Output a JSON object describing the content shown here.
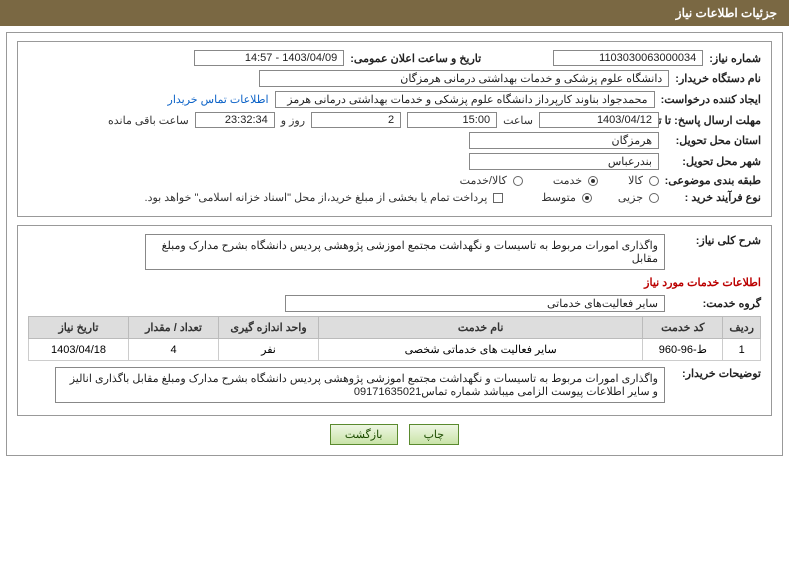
{
  "header": {
    "title": "جزئیات اطلاعات نیاز"
  },
  "fields": {
    "need_no_label": "شماره نیاز:",
    "need_no": "1103030063000034",
    "announce_label": "تاریخ و ساعت اعلان عمومی:",
    "announce": "1403/04/09 - 14:57",
    "buyer_org_label": "نام دستگاه خریدار:",
    "buyer_org": "دانشگاه علوم پزشکی و خدمات بهداشتی درمانی هرمزگان",
    "requestor_label": "ایجاد کننده درخواست:",
    "requestor": "محمدجواد بناوند کارپرداز دانشگاه علوم پزشکی و خدمات بهداشتی درمانی هرمز",
    "contact_link": "اطلاعات تماس خریدار",
    "deadline_label": "مهلت ارسال پاسخ: تا تاریخ:",
    "deadline_date": "1403/04/12",
    "time_lbl": "ساعت",
    "deadline_time": "15:00",
    "days_val": "2",
    "days_suffix": "روز و",
    "remain_time": "23:32:34",
    "remain_suffix": "ساعت باقی مانده",
    "province_label": "استان محل تحویل:",
    "province": "هرمزگان",
    "city_label": "شهر محل تحویل:",
    "city": "بندرعباس",
    "subject_cat_label": "طبقه بندی موضوعی:",
    "cat_goods": "کالا",
    "cat_service": "خدمت",
    "cat_both": "کالا/خدمت",
    "buy_type_label": "نوع فرآیند خرید :",
    "buy_partial": "جزیی",
    "buy_medium": "متوسط",
    "treasury_note": "پرداخت تمام یا بخشی از مبلغ خرید،از محل \"اسناد خزانه اسلامی\" خواهد بود.",
    "overview_label": "شرح کلی نیاز:",
    "overview": "واگذاری امورات مربوط به تاسیسات و نگهداشت مجتمع اموزشی  پژوهشی  پردیس دانشگاه  بشرح مدارک ومبلغ مقابل",
    "services_title": "اطلاعات خدمات مورد نیاز",
    "service_group_label": "گروه خدمت:",
    "service_group": "سایر فعالیت‌های خدماتی",
    "buyer_notes_label": "توضیحات خریدار:",
    "buyer_notes": "واگذاری امورات مربوط به تاسیسات و نگهداشت مجتمع اموزشی  پژوهشی  پردیس دانشگاه  بشرح مدارک ومبلغ مقابل باگذاری انالیز و  سایر اطلاعات پیوست الزامی میباشد   شماره تماس09171635021"
  },
  "table": {
    "headers": {
      "row": "ردیف",
      "code": "کد خدمت",
      "name": "نام خدمت",
      "unit": "واحد اندازه گیری",
      "qty": "تعداد / مقدار",
      "date": "تاریخ نیاز"
    },
    "rows": [
      {
        "row": "1",
        "code": "ط-96-960",
        "name": "سایر فعالیت های خدماتی شخصی",
        "unit": "نفر",
        "qty": "4",
        "date": "1403/04/18"
      }
    ]
  },
  "buttons": {
    "print": "چاپ",
    "back": "بازگشت"
  }
}
